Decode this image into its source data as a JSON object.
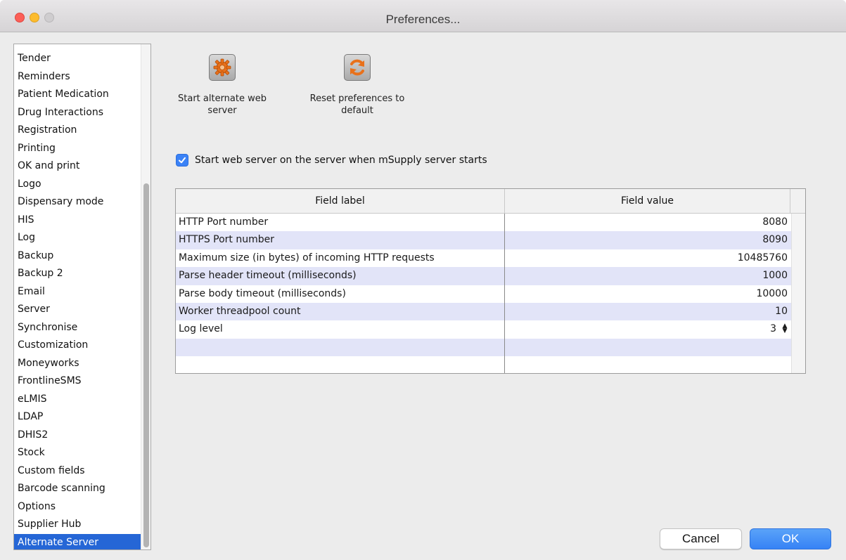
{
  "window": {
    "title": "Preferences..."
  },
  "sidebar": {
    "items": [
      {
        "label": "Tender"
      },
      {
        "label": "Reminders"
      },
      {
        "label": "Patient Medication"
      },
      {
        "label": "Drug Interactions"
      },
      {
        "label": "Registration"
      },
      {
        "label": "Printing"
      },
      {
        "label": "OK and print"
      },
      {
        "label": "Logo"
      },
      {
        "label": "Dispensary mode"
      },
      {
        "label": "HIS"
      },
      {
        "label": "Log"
      },
      {
        "label": "Backup"
      },
      {
        "label": "Backup 2"
      },
      {
        "label": "Email"
      },
      {
        "label": "Server"
      },
      {
        "label": "Synchronise"
      },
      {
        "label": "Customization"
      },
      {
        "label": "Moneyworks"
      },
      {
        "label": "FrontlineSMS"
      },
      {
        "label": "eLMIS"
      },
      {
        "label": "LDAP"
      },
      {
        "label": "DHIS2"
      },
      {
        "label": "Stock"
      },
      {
        "label": "Custom fields"
      },
      {
        "label": "Barcode scanning"
      },
      {
        "label": "Options"
      },
      {
        "label": "Supplier Hub"
      },
      {
        "label": "Alternate Server"
      }
    ],
    "selected": "Alternate Server"
  },
  "toolbar": {
    "start_server_label": "Start alternate web server",
    "reset_label": "Reset preferences to default"
  },
  "checkbox": {
    "label": "Start web server on the server when mSupply server starts",
    "checked": true
  },
  "table": {
    "headers": [
      "Field label",
      "Field value"
    ],
    "rows": [
      {
        "label": "HTTP Port number",
        "value": "8080"
      },
      {
        "label": "HTTPS Port number",
        "value": "8090"
      },
      {
        "label": "Maximum size (in bytes) of incoming HTTP requests",
        "value": "10485760"
      },
      {
        "label": "Parse header timeout (milliseconds)",
        "value": "1000"
      },
      {
        "label": "Parse body timeout (milliseconds)",
        "value": "10000"
      },
      {
        "label": "Worker threadpool count",
        "value": "10"
      },
      {
        "label": "Log level",
        "value": "3"
      },
      {
        "label": "",
        "value": ""
      },
      {
        "label": "",
        "value": ""
      }
    ]
  },
  "buttons": {
    "cancel": "Cancel",
    "ok": "OK"
  },
  "colors": {
    "selection": "#2566d6",
    "row_alt": "#e2e4f8",
    "ok_button": "#3682f5",
    "checkbox": "#3b82f6"
  }
}
